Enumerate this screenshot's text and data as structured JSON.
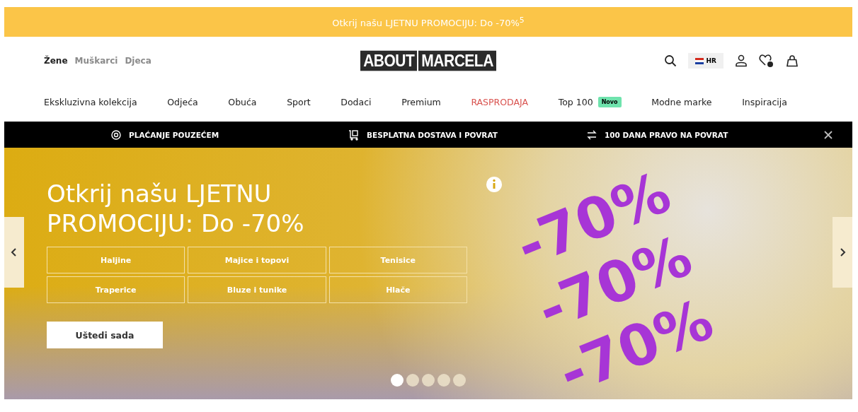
{
  "promo_bar": {
    "text": "Otkrij našu LJETNU PROMOCIJU: Do -70%$^{5}$"
  },
  "gender_tabs": [
    {
      "label": "Žene",
      "selected": true
    },
    {
      "label": "Muškarci",
      "selected": false
    },
    {
      "label": "Djeca",
      "selected": false
    }
  ],
  "logo": {
    "parts": [
      "ABOUT",
      "MARCELA"
    ]
  },
  "language": {
    "label": "HR"
  },
  "nav": [
    {
      "label": "Ekskluzivna kolekcija",
      "kind": "normal"
    },
    {
      "label": "Odjeća",
      "kind": "normal"
    },
    {
      "label": "Obuća",
      "kind": "normal"
    },
    {
      "label": "Sport",
      "kind": "normal"
    },
    {
      "label": "Dodaci",
      "kind": "normal"
    },
    {
      "label": "Premium",
      "kind": "normal"
    },
    {
      "label": "RASPRODAJA",
      "kind": "sale"
    },
    {
      "label": "Top 100",
      "kind": "normal",
      "badge": "Novo"
    },
    {
      "label": "Modne marke",
      "kind": "normal"
    },
    {
      "label": "Inspiracija",
      "kind": "normal"
    }
  ],
  "benefits": [
    {
      "label": "PLAĆANJE POUZEĆEM",
      "kind": "cash"
    },
    {
      "label": "BESPLATNA DOSTAVA I POVRAT",
      "kind": "delivery"
    },
    {
      "label": "100 DANA PRAVO NA POVRAT",
      "kind": "return"
    }
  ],
  "hero": {
    "title": "Otkrij našu LJETNU PROMOCIJU: Do -70%",
    "categories": [
      "Haljine",
      "Majice i topovi",
      "Tenisice",
      "Traperice",
      "Bluze i tunike",
      "Hlače"
    ],
    "cta": "Uštedi sada",
    "artwork_texts": [
      "-70%",
      "-70%",
      "-70%"
    ],
    "slides": [
      {
        "selected": true
      },
      {
        "selected": false
      },
      {
        "selected": false
      },
      {
        "selected": false
      },
      {
        "selected": false
      }
    ]
  }
}
